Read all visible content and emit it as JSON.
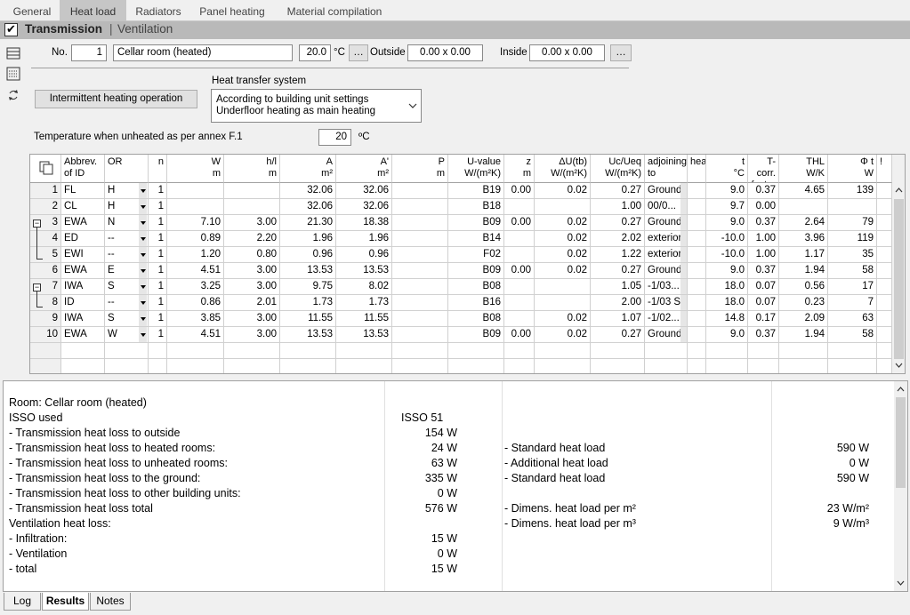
{
  "tabs": [
    "General",
    "Heat load",
    "Radiators",
    "Panel heating",
    "Material compilation"
  ],
  "section": {
    "transmission": "Transmission",
    "ventilation": "Ventilation"
  },
  "room": {
    "no_label": "No.",
    "no": "1",
    "name": "Cellar room (heated)",
    "temp": "20.0",
    "temp_unit": "°C",
    "dots": "…",
    "outside_label": "Outside",
    "outside": "0.00 x 0.00",
    "inside_label": "Inside",
    "inside": "0.00 x 0.00"
  },
  "intermittent_button": "Intermittent heating operation",
  "hts_label": "Heat transfer system",
  "hts_line1": "According to building unit settings",
  "hts_line2": "Underfloor heating as main heating",
  "unheated_label": "Temperature when unheated as per annex F.1",
  "unheated_value": "20",
  "unheated_unit": "ºC",
  "headers": {
    "abbrev1": "Abbrev.",
    "abbrev2": "of ID",
    "or": "OR",
    "n": "n",
    "w1": "W",
    "w2": "m",
    "hl1": "h/l",
    "hl2": "m",
    "a1": "A",
    "a2": "m²",
    "ap1": "A'",
    "ap2": "m²",
    "p1": "P",
    "p2": "m",
    "u1": "U-value",
    "u2": "W/(m²K)",
    "z1": "z",
    "z2": "m",
    "du1": "ΔU(tb)",
    "du2": "W/(m²K)",
    "uc1": "Uc/Ueq",
    "uc2": "W/(m²K)",
    "adj1": "adjoining",
    "adj2": "to",
    "hea": "hea",
    "t1": "t",
    "t2": "°C",
    "tc1": "T-corr.",
    "tc2": "factor",
    "thl1": "THL",
    "thl2": "W/K",
    "phi1": "Φ t",
    "phi2": "W",
    "excl": "!"
  },
  "rows": [
    {
      "no": "1",
      "id": "FL",
      "or": "H",
      "n": "1",
      "w": "",
      "hl": "",
      "a": "32.06",
      "ap": "32.06",
      "p": "",
      "u": "B19",
      "z": "0.00",
      "du": "0.02",
      "uc": "0.27",
      "adj": "Ground ···",
      "t": "9.0",
      "tc": "0.37",
      "thl": "4.65",
      "phi": "139"
    },
    {
      "no": "2",
      "id": "CL",
      "or": "H",
      "n": "1",
      "w": "",
      "hl": "",
      "a": "32.06",
      "ap": "32.06",
      "p": "",
      "u": "B18",
      "z": "",
      "du": "",
      "uc": "1.00",
      "adj": "00/0...",
      "t": "9.7",
      "tc": "0.00",
      "thl": "",
      "phi": ""
    },
    {
      "no": "3",
      "id": "EWA",
      "or": "N",
      "n": "1",
      "w": "7.10",
      "hl": "3.00",
      "a": "21.30",
      "ap": "18.38",
      "p": "",
      "u": "B09",
      "z": "0.00",
      "du": "0.02",
      "uc": "0.27",
      "adj": "Ground ···",
      "t": "9.0",
      "tc": "0.37",
      "thl": "2.64",
      "phi": "79"
    },
    {
      "no": "4",
      "id": "ED",
      "or": "--",
      "n": "1",
      "w": "0.89",
      "hl": "2.20",
      "a": "1.96",
      "ap": "1.96",
      "p": "",
      "u": "B14",
      "z": "",
      "du": "0.02",
      "uc": "2.02",
      "adj": "exterior",
      "t": "-10.0",
      "tc": "1.00",
      "thl": "3.96",
      "phi": "119"
    },
    {
      "no": "5",
      "id": "EWI",
      "or": "--",
      "n": "1",
      "w": "1.20",
      "hl": "0.80",
      "a": "0.96",
      "ap": "0.96",
      "p": "",
      "u": "F02",
      "z": "",
      "du": "0.02",
      "uc": "1.22",
      "adj": "exterior",
      "t": "-10.0",
      "tc": "1.00",
      "thl": "1.17",
      "phi": "35"
    },
    {
      "no": "6",
      "id": "EWA",
      "or": "E",
      "n": "1",
      "w": "4.51",
      "hl": "3.00",
      "a": "13.53",
      "ap": "13.53",
      "p": "",
      "u": "B09",
      "z": "0.00",
      "du": "0.02",
      "uc": "0.27",
      "adj": "Ground ···",
      "t": "9.0",
      "tc": "0.37",
      "thl": "1.94",
      "phi": "58"
    },
    {
      "no": "7",
      "id": "IWA",
      "or": "S",
      "n": "1",
      "w": "3.25",
      "hl": "3.00",
      "a": "9.75",
      "ap": "8.02",
      "p": "",
      "u": "B08",
      "z": "",
      "du": "",
      "uc": "1.05",
      "adj": "-1/03...",
      "t": "18.0",
      "tc": "0.07",
      "thl": "0.56",
      "phi": "17"
    },
    {
      "no": "8",
      "id": "ID",
      "or": "--",
      "n": "1",
      "w": "0.86",
      "hl": "2.01",
      "a": "1.73",
      "ap": "1.73",
      "p": "",
      "u": "B16",
      "z": "",
      "du": "",
      "uc": "2.00",
      "adj": "-1/03 S...",
      "t": "18.0",
      "tc": "0.07",
      "thl": "0.23",
      "phi": "7"
    },
    {
      "no": "9",
      "id": "IWA",
      "or": "S",
      "n": "1",
      "w": "3.85",
      "hl": "3.00",
      "a": "11.55",
      "ap": "11.55",
      "p": "",
      "u": "B08",
      "z": "",
      "du": "0.02",
      "uc": "1.07",
      "adj": "-1/02...",
      "t": "14.8",
      "tc": "0.17",
      "thl": "2.09",
      "phi": "63"
    },
    {
      "no": "10",
      "id": "EWA",
      "or": "W",
      "n": "1",
      "w": "4.51",
      "hl": "3.00",
      "a": "13.53",
      "ap": "13.53",
      "p": "",
      "u": "B09",
      "z": "0.00",
      "du": "0.02",
      "uc": "0.27",
      "adj": "Ground ···",
      "t": "9.0",
      "tc": "0.37",
      "thl": "1.94",
      "phi": "58"
    }
  ],
  "results": {
    "room": "Room: Cellar room (heated)",
    "isso_label": "ISSO used",
    "isso_value": "ISSO 51",
    "left": [
      {
        "label": "- Transmission heat loss to outside",
        "value": "154 W"
      },
      {
        "label": "- Transmission heat loss to heated rooms:",
        "value": "24 W"
      },
      {
        "label": "- Transmission heat loss to unheated rooms:",
        "value": "63 W"
      },
      {
        "label": "- Transmission heat loss to the ground:",
        "value": "335 W"
      },
      {
        "label": "- Transmission heat loss to other building units:",
        "value": "0 W"
      },
      {
        "label": "- Transmission heat loss total",
        "value": "576 W"
      }
    ],
    "vent_label": "Ventilation heat loss:",
    "vent": [
      {
        "label": "- Infiltration:",
        "value": "15 W"
      },
      {
        "label": "- Ventilation",
        "value": "0 W"
      },
      {
        "label": "- total",
        "value": "15 W"
      }
    ],
    "right": [
      {
        "label": "- Standard heat load",
        "value": "590 W"
      },
      {
        "label": "- Additional heat load",
        "value": "0 W"
      },
      {
        "label": "- Standard heat load",
        "value": "590 W"
      },
      {
        "label": "- Dimens. heat load per m²",
        "value": "23 W/m²"
      },
      {
        "label": "- Dimens. heat load per m³",
        "value": "9 W/m³"
      }
    ]
  },
  "bottom_tabs": [
    "Log",
    "Results",
    "Notes"
  ]
}
